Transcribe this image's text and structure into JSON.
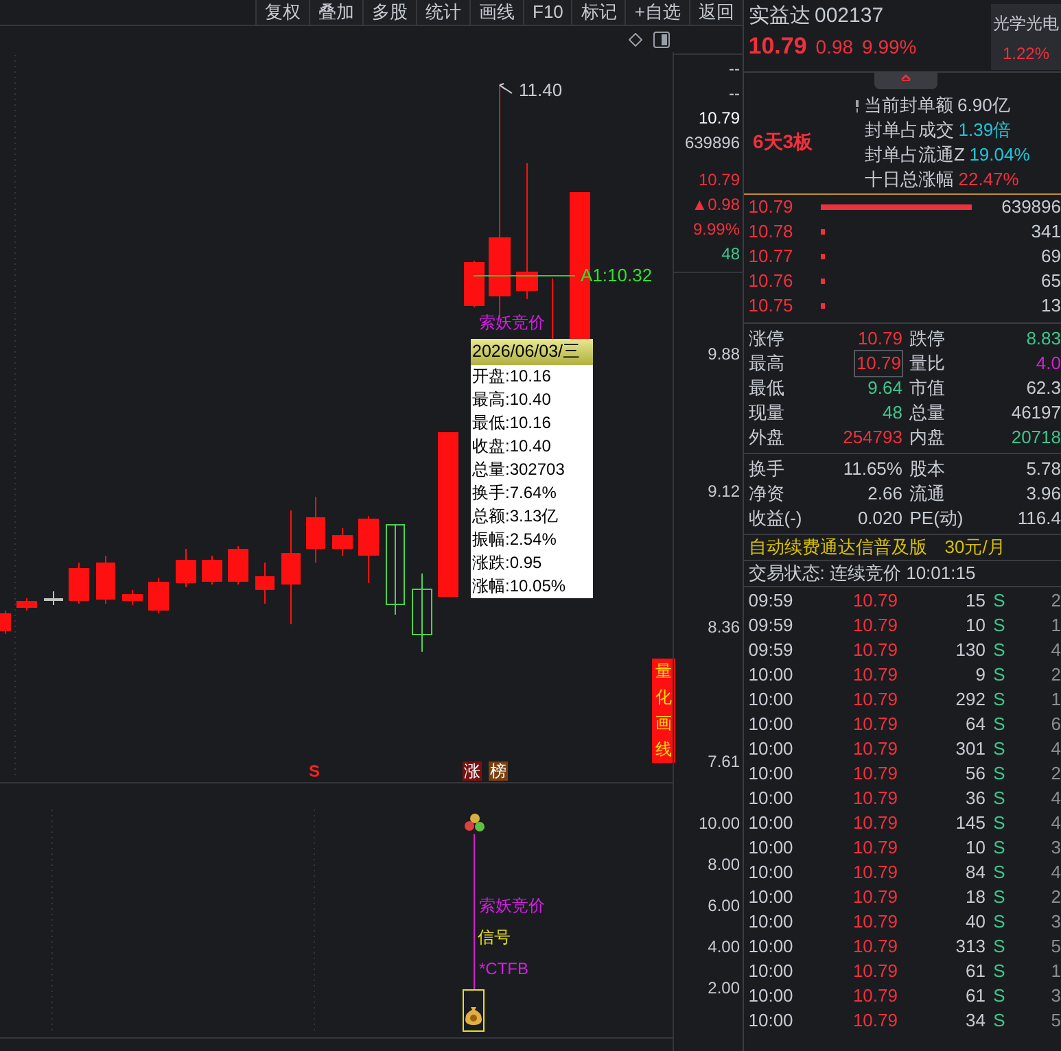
{
  "toolbar": {
    "buttons": [
      "复权",
      "叠加",
      "多股",
      "统计",
      "画线",
      "F10",
      "标记",
      "+自选",
      "返回"
    ]
  },
  "chart": {
    "high_label": "11.40",
    "line_label": "A1:10.32",
    "signal_label": "索妖竞价",
    "axis_info": [
      {
        "text": "--",
        "kind": "flat"
      },
      {
        "text": "--",
        "kind": "flat"
      },
      {
        "text": "10.79",
        "kind": "bright"
      },
      {
        "text": "639896",
        "kind": "flat"
      }
    ],
    "axis_quote": [
      {
        "text": "10.79",
        "kind": "up"
      },
      {
        "text": "▲0.98",
        "kind": "up"
      },
      {
        "text": "9.99%",
        "kind": "up"
      },
      {
        "text": "48",
        "kind": "down"
      }
    ],
    "yticks": [
      "9.88",
      "9.12",
      "8.36",
      "7.61"
    ],
    "side_tag": "量化画线",
    "markers": [
      {
        "text": "S",
        "kind": "sell"
      },
      {
        "text": "涨",
        "kind": "rise"
      },
      {
        "text": "榜",
        "kind": "list"
      }
    ],
    "tooltip": {
      "title": "2026/06/03/三",
      "lines": [
        "开盘:10.16",
        "最高:10.40",
        "最低:10.16",
        "收盘:10.40",
        "总量:302703",
        "换手:7.64%",
        "总额:3.13亿",
        "振幅:2.54%",
        "涨跌:0.95",
        "涨幅:10.05%"
      ]
    }
  },
  "indicator": {
    "yticks": [
      "10.00",
      "8.00",
      "6.00",
      "4.00",
      "2.00"
    ],
    "labels": [
      {
        "text": "索妖竞价",
        "kind": "signal"
      },
      {
        "text": "信号",
        "kind": "note"
      },
      {
        "text": "*CTFB",
        "kind": "signal"
      }
    ]
  },
  "quote": {
    "name": "实益达",
    "code": "002137",
    "price": "10.79",
    "change": "0.98",
    "pct": "9.99%",
    "sector": {
      "name": "光学光电",
      "pct": "1.22%"
    }
  },
  "seal": {
    "streak": "6天3板",
    "items": [
      {
        "label": "当前封单额",
        "value": "6.90亿",
        "kind": "amount"
      },
      {
        "label": "封单占成交",
        "value": "1.39倍",
        "kind": "ratio"
      },
      {
        "label": "封单占流通Z",
        "value": "19.04%",
        "kind": "ratio"
      },
      {
        "label": "十日总涨幅",
        "value": "22.47%",
        "kind": "gain"
      }
    ]
  },
  "order_book": [
    {
      "price": "10.79",
      "volume": "639896"
    },
    {
      "price": "10.78",
      "volume": "341"
    },
    {
      "price": "10.77",
      "volume": "69"
    },
    {
      "price": "10.76",
      "volume": "65"
    },
    {
      "price": "10.75",
      "volume": "13"
    }
  ],
  "stats": [
    [
      {
        "label": "涨停",
        "value": "10.79",
        "kind": "up",
        "boxed": false
      },
      {
        "label": "跌停",
        "value": "8.83",
        "kind": "down",
        "boxed": false
      }
    ],
    [
      {
        "label": "最高",
        "value": "10.79",
        "kind": "up",
        "boxed": true
      },
      {
        "label": "量比",
        "value": "4.0",
        "kind": "special",
        "boxed": false
      }
    ],
    [
      {
        "label": "最低",
        "value": "9.64",
        "kind": "down",
        "boxed": false
      },
      {
        "label": "市值",
        "value": "62.3",
        "kind": "flat",
        "boxed": false
      }
    ],
    [
      {
        "label": "现量",
        "value": "48",
        "kind": "down",
        "boxed": false
      },
      {
        "label": "总量",
        "value": "46197",
        "kind": "flat",
        "boxed": false
      }
    ],
    [
      {
        "label": "外盘",
        "value": "254793",
        "kind": "up",
        "boxed": false
      },
      {
        "label": "内盘",
        "value": "20718",
        "kind": "down",
        "boxed": false
      }
    ]
  ],
  "finance": [
    [
      {
        "label": "换手",
        "value": "11.65%"
      },
      {
        "label": "股本",
        "value": "5.78"
      }
    ],
    [
      {
        "label": "净资",
        "value": "2.66"
      },
      {
        "label": "流通",
        "value": "3.96"
      }
    ],
    [
      {
        "label": "收益(-)",
        "value": "0.020"
      },
      {
        "label": "PE(动)",
        "value": "116.4"
      }
    ]
  ],
  "promo": {
    "text": "自动续费通达信普及版",
    "price": "30元/月"
  },
  "trade_status": "交易状态: 连续竞价 10:01:15",
  "trades": [
    {
      "time": "09:59",
      "price": "10.79",
      "volume": "15",
      "side": "S",
      "column_5": "2"
    },
    {
      "time": "09:59",
      "price": "10.79",
      "volume": "10",
      "side": "S",
      "column_5": "1"
    },
    {
      "time": "09:59",
      "price": "10.79",
      "volume": "130",
      "side": "S",
      "column_5": "4"
    },
    {
      "time": "10:00",
      "price": "10.79",
      "volume": "9",
      "side": "S",
      "column_5": "2"
    },
    {
      "time": "10:00",
      "price": "10.79",
      "volume": "292",
      "side": "S",
      "column_5": "1"
    },
    {
      "time": "10:00",
      "price": "10.79",
      "volume": "64",
      "side": "S",
      "column_5": "6"
    },
    {
      "time": "10:00",
      "price": "10.79",
      "volume": "301",
      "side": "S",
      "column_5": "4"
    },
    {
      "time": "10:00",
      "price": "10.79",
      "volume": "56",
      "side": "S",
      "column_5": "2"
    },
    {
      "time": "10:00",
      "price": "10.79",
      "volume": "36",
      "side": "S",
      "column_5": "4"
    },
    {
      "time": "10:00",
      "price": "10.79",
      "volume": "145",
      "side": "S",
      "column_5": "4"
    },
    {
      "time": "10:00",
      "price": "10.79",
      "volume": "10",
      "side": "S",
      "column_5": "3"
    },
    {
      "time": "10:00",
      "price": "10.79",
      "volume": "84",
      "side": "S",
      "column_5": "4"
    },
    {
      "time": "10:00",
      "price": "10.79",
      "volume": "18",
      "side": "S",
      "column_5": "2"
    },
    {
      "time": "10:00",
      "price": "10.79",
      "volume": "40",
      "side": "S",
      "column_5": "3"
    },
    {
      "time": "10:00",
      "price": "10.79",
      "volume": "313",
      "side": "S",
      "column_5": "5"
    },
    {
      "time": "10:00",
      "price": "10.79",
      "volume": "61",
      "side": "S",
      "column_5": "1"
    },
    {
      "time": "10:00",
      "price": "10.79",
      "volume": "61",
      "side": "S",
      "column_5": "3"
    },
    {
      "time": "10:00",
      "price": "10.79",
      "volume": "34",
      "side": "S",
      "column_5": "5"
    }
  ]
}
